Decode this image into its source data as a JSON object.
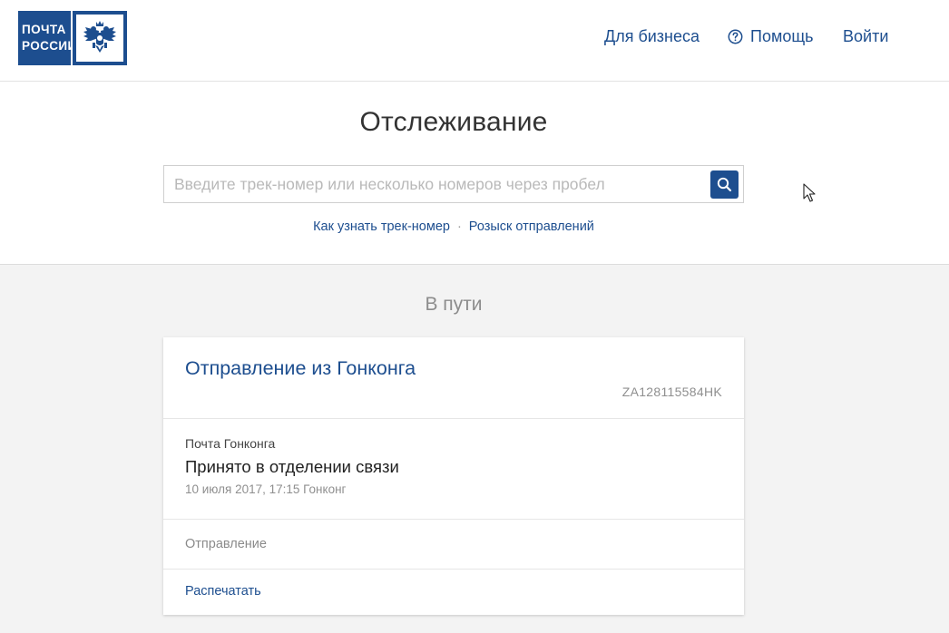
{
  "logo": {
    "line1": "ПОЧТА",
    "line2": "РОССИИ"
  },
  "nav": {
    "business": "Для бизнеса",
    "help": "Помощь",
    "login": "Войти"
  },
  "tracking": {
    "title": "Отслеживание",
    "search_placeholder": "Введите трек-номер или несколько номеров через пробел",
    "search_value": "",
    "link_how": "Как узнать трек-номер",
    "separator": "·",
    "link_search": "Розыск отправлений"
  },
  "status_heading": "В пути",
  "shipment": {
    "title": "Отправление из Гонконга",
    "track_number": "ZA128115584HK",
    "event": {
      "organization": "Почта Гонконга",
      "status": "Принято в отделении связи",
      "date": "10 июля 2017, 17:15 Гонконг"
    },
    "details_label": "Отправление",
    "print_label": "Распечатать"
  },
  "colors": {
    "brand": "#1d4e8f",
    "page_bg": "#f3f3f3",
    "muted_text": "#8f8f8f"
  }
}
